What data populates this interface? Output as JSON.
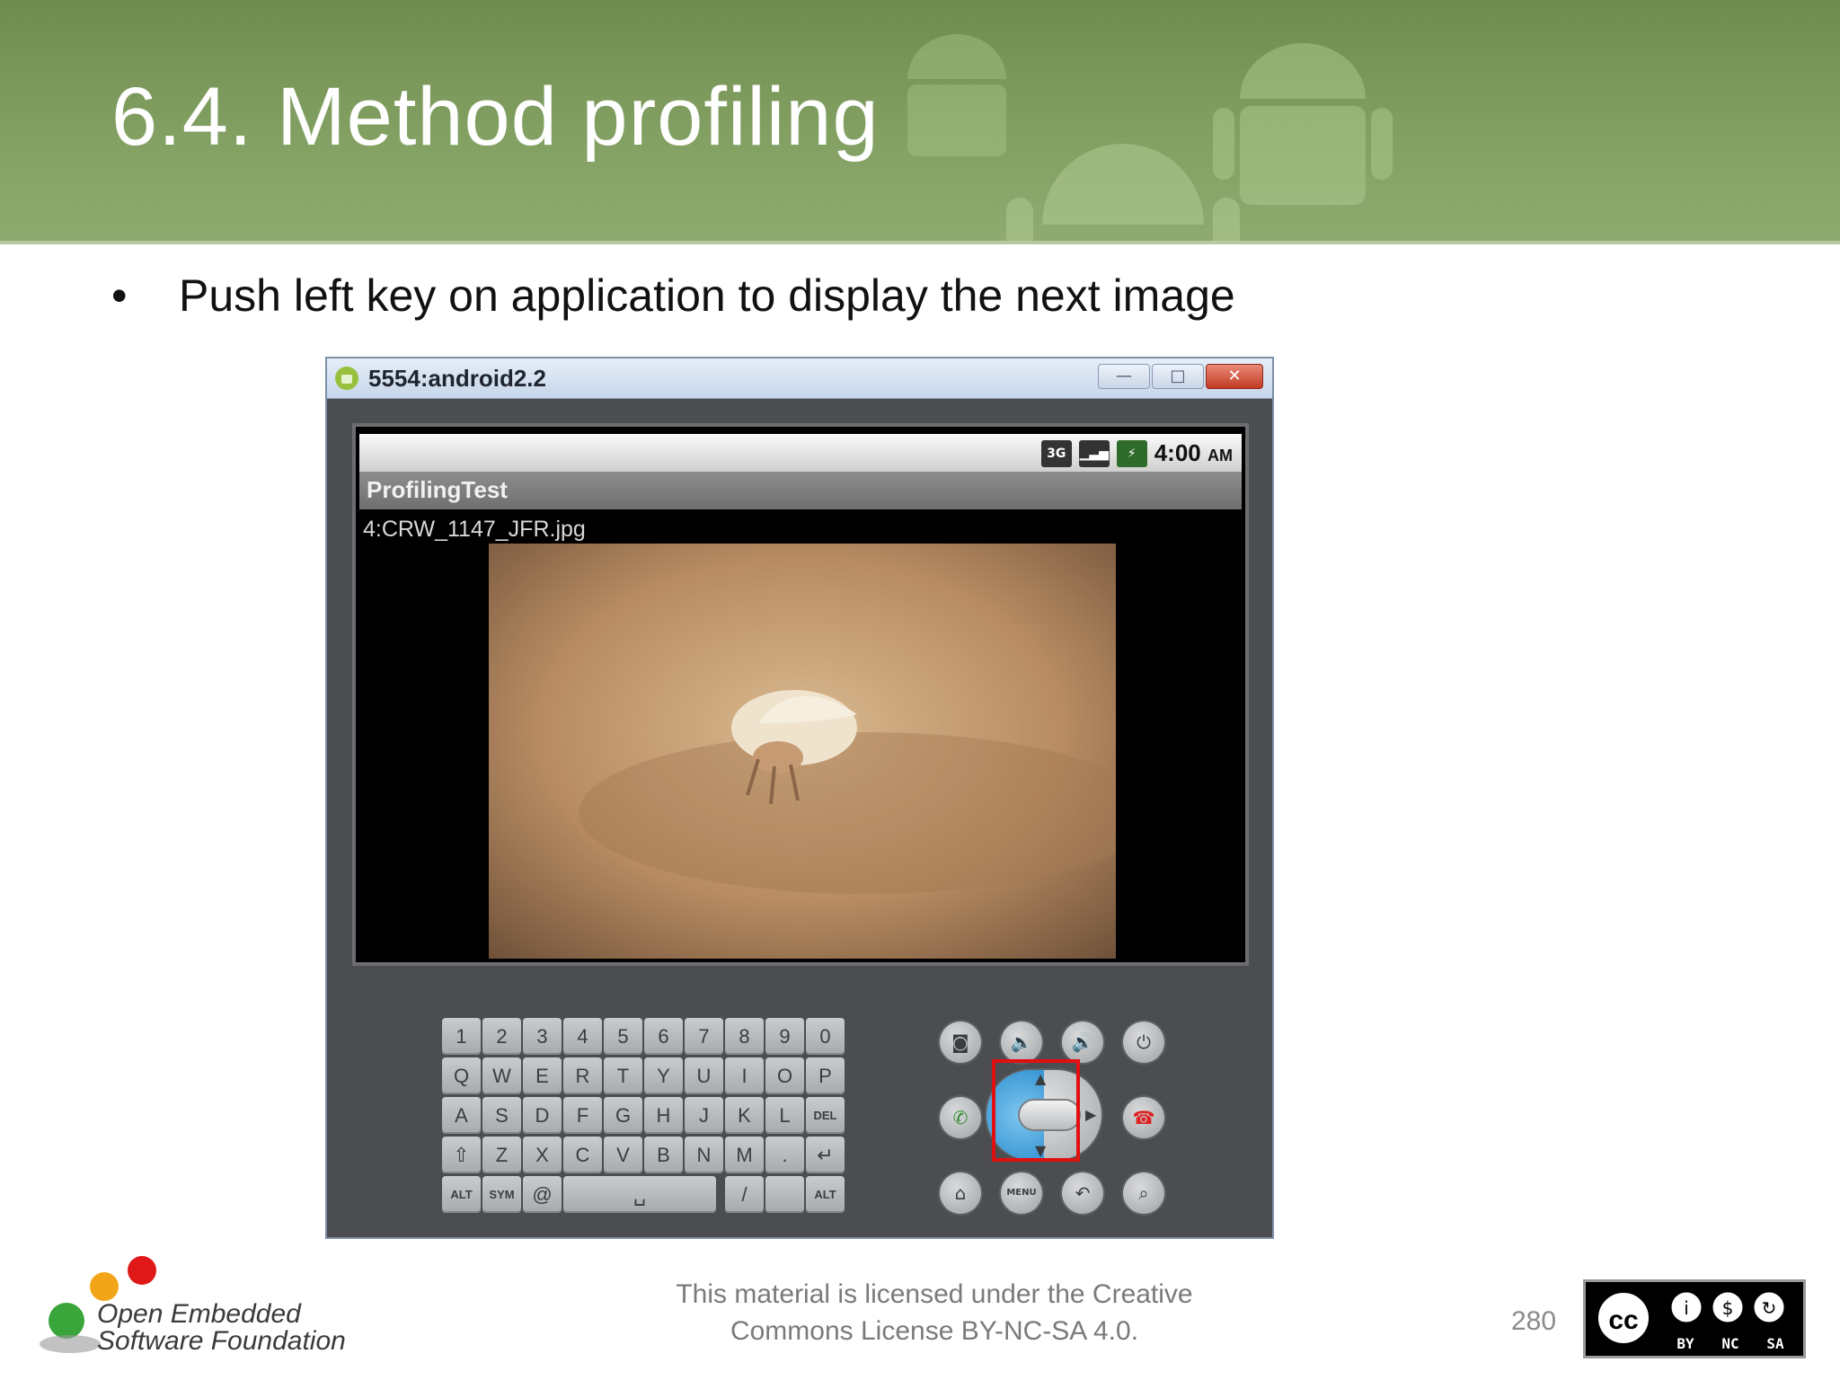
{
  "slide": {
    "title": "6.4. Method profiling",
    "bullet": "Push left key on application to display the next image"
  },
  "emulator": {
    "window_title": "5554:android2.2",
    "status": {
      "network": "3G",
      "time": "4:00",
      "ampm": "AM"
    },
    "app_name": "ProfilingTest",
    "file_label": "4:CRW_1147_JFR.jpg",
    "keyboard_rows": [
      [
        "1",
        "2",
        "3",
        "4",
        "5",
        "6",
        "7",
        "8",
        "9",
        "0"
      ],
      [
        "Q",
        "W",
        "E",
        "R",
        "T",
        "Y",
        "U",
        "I",
        "O",
        "P"
      ],
      [
        "A",
        "S",
        "D",
        "F",
        "G",
        "H",
        "J",
        "K",
        "L",
        "DEL"
      ],
      [
        "⇧",
        "Z",
        "X",
        "C",
        "V",
        "B",
        "N",
        "M",
        ".",
        "↵"
      ]
    ],
    "keyboard_bottom": {
      "alt_left": "ALT",
      "sym": "SYM",
      "at": "@",
      "slash": "/",
      "alt_right": "ALT"
    },
    "controls": {
      "menu": "MENU"
    }
  },
  "footer": {
    "logo_line1": "Open Embedded",
    "logo_line2": "Software Foundation",
    "license_line1": "This material is licensed under the Creative",
    "license_line2": "Commons License BY-NC-SA 4.0.",
    "page_number": "280",
    "cc_labels": [
      "BY",
      "NC",
      "SA"
    ]
  },
  "colors": {
    "banner": "#7a9659",
    "highlight": "#e01010",
    "close_button": "#c33b24"
  }
}
